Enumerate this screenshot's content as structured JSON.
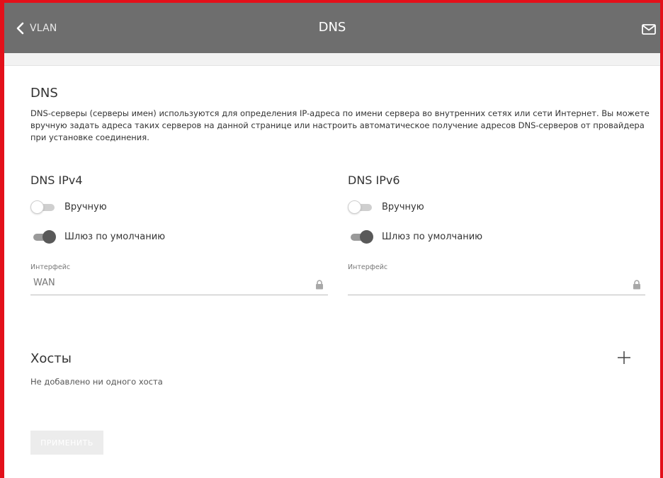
{
  "header": {
    "back_label": "VLAN",
    "title": "DNS"
  },
  "dns_section": {
    "title": "DNS",
    "description": "DNS-серверы (серверы имен) используются для определения IP-адреса по имени сервера во внутренних сетях или сети Интернет. Вы можете вручную задать адреса таких серверов на данной странице или настроить автоматическое получение адресов DNS-серверов от провайдера при установке соединения."
  },
  "ipv4": {
    "title": "DNS IPv4",
    "manual_label": "Вручную",
    "manual_on": false,
    "gateway_label": "Шлюз по умолчанию",
    "gateway_on": true,
    "interface_label": "Интерфейс",
    "interface_value": "WAN"
  },
  "ipv6": {
    "title": "DNS IPv6",
    "manual_label": "Вручную",
    "manual_on": false,
    "gateway_label": "Шлюз по умолчанию",
    "gateway_on": true,
    "interface_label": "Интерфейс",
    "interface_value": ""
  },
  "hosts": {
    "title": "Хосты",
    "empty_text": "Не добавлено ни одного хоста"
  },
  "apply_label": "ПРИМЕНИТЬ",
  "icons": {
    "back": "chevron-left-icon",
    "mail": "mail-icon",
    "lock": "lock-icon",
    "add": "plus-icon"
  },
  "colors": {
    "header_bg": "#6e6e6e",
    "frame_border": "#e3101a",
    "toggle_on": "#595959",
    "toggle_off": "#cfcfcf"
  }
}
